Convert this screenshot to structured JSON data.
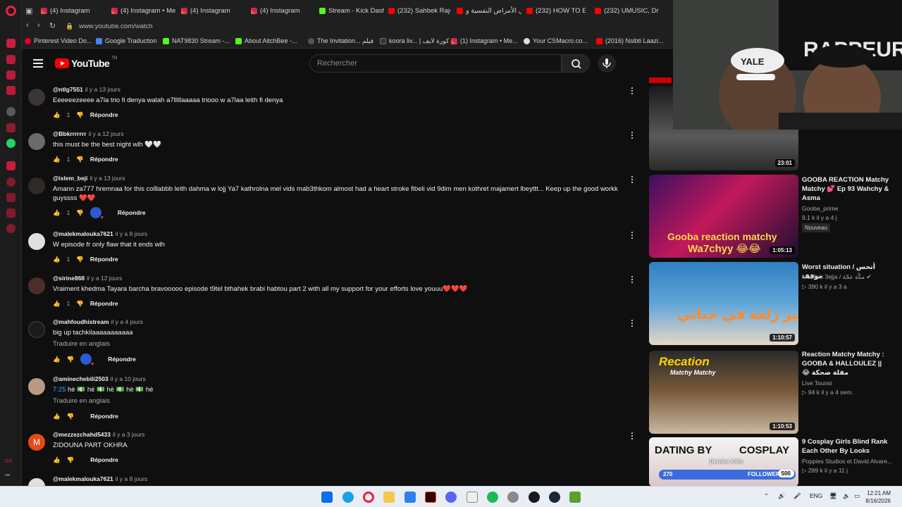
{
  "browser": {
    "url": "www.youtube.com/watch",
    "tabs": [
      {
        "label": "(4) Instagram",
        "kind": "ig"
      },
      {
        "label": "(4) Instagram • Me",
        "kind": "ig"
      },
      {
        "label": "(4) Instagram",
        "kind": "ig"
      },
      {
        "label": "(4) Instagram",
        "kind": "ig"
      },
      {
        "label": "Stream - Kick Dash",
        "kind": "kick"
      },
      {
        "label": "(232) Sahbek Rajel",
        "kind": "yt"
      },
      {
        "label": "كل الأمراض النفسية و",
        "kind": "yt"
      },
      {
        "label": "(232) HOW TO EA",
        "kind": "yt"
      },
      {
        "label": "(232) UMUSIC, Dr",
        "kind": "yt"
      }
    ],
    "bookmarks": [
      "Pinterest Video Do...",
      "Google Traduction",
      "NAT9830 Stream -...",
      "About AitchBee -...",
      "The Invitation... فيلم",
      "koora liv... | كورة لايف",
      "(1) Instagram • Me...",
      "Your CSMacro.co...",
      "(2016) Nsibti Laazi..."
    ]
  },
  "youtube": {
    "logo_text": "YouTube",
    "country_code": "TN",
    "search_placeholder": "Rechercher"
  },
  "comments": [
    {
      "author": "@ntlg7551",
      "time": "il y a 13 jours",
      "text": "Eeeeeezeeee a7la trio fi denya walah a7lllllaaaaa triooo w a7laa leith fi denya",
      "likes": "1",
      "reply": "Répondre"
    },
    {
      "author": "@Bbkrrrrrrr",
      "time": "il y a 12 jours",
      "text": "this must be the best night wlh 🤍🤍",
      "likes": "1",
      "reply": "Répondre"
    },
    {
      "author": "@islem_beji",
      "time": "il y a 13 jours",
      "text": "Amann za777 hremnaa for this colllabbb leith dahma w lojj Ya7 kathrolna mel vids mab3thkom almost had a heart stroke fibeli vid 9dim men kothret majamert lbeyttt... Keep up the good workk guyssss ❤️❤️",
      "likes": "1",
      "reply": "Répondre"
    },
    {
      "author": "@malekmalouka7621",
      "time": "il y a 8 jours",
      "text": "W episode fr only flaw that it ends wlh",
      "likes": "1",
      "reply": "Répondre"
    },
    {
      "author": "@sirine868",
      "time": "il y a 12 jours",
      "text": "Vraiment khedma Tayara barcha bravooooo episode t9tel bthahek brabi habtou part 2 with all my support for your efforts love youuu❤️❤️❤️",
      "likes": "1",
      "reply": "Répondre"
    },
    {
      "author": "@mahfoudhistream",
      "time": "il y a 4 jours",
      "text": "big up tachkilaaaaaaaaaaa",
      "translate": "Traduire en anglais",
      "reply": "Répondre"
    },
    {
      "author": "@aminechebili2503",
      "time": "il y a 10 jours",
      "time_link": "7:25",
      "text": "hè 💵 hè 💵 hè 💵 hè 💵 hè",
      "translate": "Traduire en anglais",
      "reply": "Répondre"
    },
    {
      "author": "@mezzezchahd5433",
      "time": "il y a 3 jours",
      "avatar_letter": "M",
      "text": "ZIDOUNA PART OKHRA",
      "reply": "Répondre"
    },
    {
      "author": "@malekmalouka7621",
      "time": "il y a 8 jours"
    }
  ],
  "related": [
    {
      "duration": "23:01"
    },
    {
      "title": "GOOBA REACTION Matchy Matchy 💕 Ep 93 Wahchy & Asma",
      "channel": "Gooba_prime",
      "meta": "9,1 k  il y a 4 j",
      "badge": "Nouveau",
      "duration": "1:05:13",
      "thumb_text": "Gooba reaction matchy",
      "thumb_text2": "Wa7chyy 😂😂"
    },
    {
      "title": "Worst situation / أتحس موقف",
      "channel": "Mo55ek 3ejja / مكّة عجّة ✔",
      "meta": "▷ 390 k   il y a 3 a",
      "duration": "1:10:57",
      "thumb_text": "أخير زلعة في حياتي"
    },
    {
      "title": "Reaction Matchy Matchy : GOOBA & HALLOULEZ || 😂 مقلة ضحكة",
      "channel": "Live Tounsi",
      "meta": "▷ 94 k   il y a 4 sem.",
      "duration": "1:10:53",
      "thumb_text": "Recation",
      "thumb_text2": "Matchy Matchy"
    },
    {
      "title": "9 Cosplay Girls Blind Rank Each Other By Looks",
      "channel": "Poppies Studios et David Alvare...",
      "meta": "▷ 289 k   il y a 11 j",
      "thumb_text": "DATING BY",
      "thumb_text2": "COSPLAY",
      "overlay_left": "270",
      "overlay_mid": "FOLLOWERS",
      "overlay_right": "500",
      "overlay_top": "Dernier follo"
    }
  ],
  "webcam": {
    "cap_text": "YALE",
    "wall_text": "RAPPEUR"
  },
  "taskbar": {
    "lang": "ENG",
    "time": "12:21 AM",
    "date": "8/16/2026"
  },
  "colors": {
    "youtube_red": "#ff0000",
    "opera_red": "#e8213f",
    "link_blue": "#3ea6ff",
    "bg": "#0f0f0f"
  }
}
